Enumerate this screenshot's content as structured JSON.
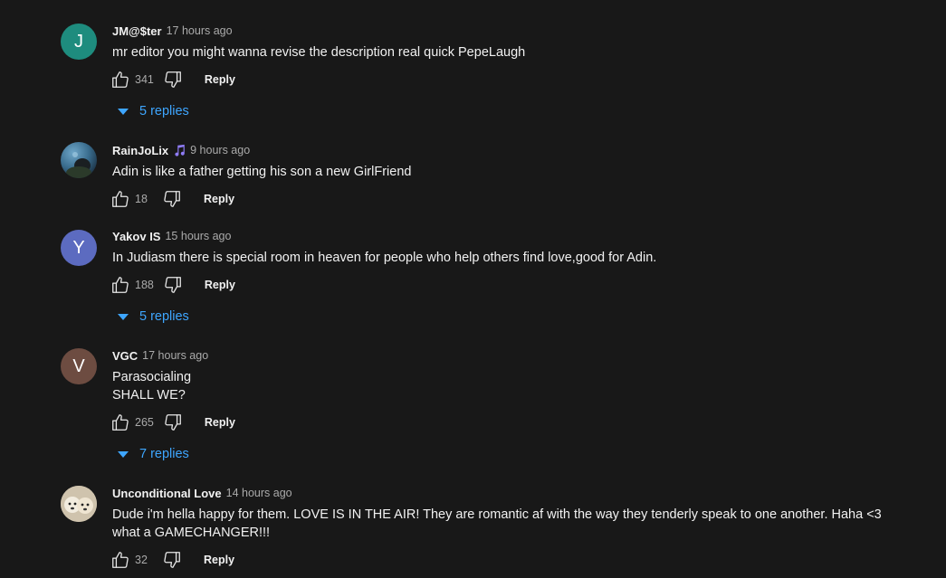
{
  "comments": [
    {
      "author": "JM@$ter",
      "time": "17 hours ago",
      "text": "mr editor you might wanna revise the description real quick PepeLaugh",
      "likes": "341",
      "reply_label": "Reply",
      "replies_label": "5 replies",
      "avatar_letter": "J",
      "avatar_color": "#1e8c7e"
    },
    {
      "author": "RainJoLix",
      "time": "9 hours ago",
      "text": "Adin is like a father getting his son a new GirlFriend",
      "likes": "18",
      "reply_label": "Reply",
      "badge_icon": "music-note-icon",
      "badge_color": "#8f7cf7"
    },
    {
      "author": "Yakov IS",
      "time": "15 hours ago",
      "text": "In Judiasm there is special room in heaven for people who help others find love,good for Adin.",
      "likes": "188",
      "reply_label": "Reply",
      "replies_label": "5 replies",
      "avatar_letter": "Y",
      "avatar_color": "#5c6bc0"
    },
    {
      "author": "VGC",
      "time": "17 hours ago",
      "text": "Parasocialing\nSHALL WE?",
      "likes": "265",
      "reply_label": "Reply",
      "replies_label": "7 replies",
      "avatar_letter": "V",
      "avatar_color": "#6d4c41"
    },
    {
      "author": "Unconditional Love",
      "time": "14 hours ago",
      "text": "Dude i'm hella happy for them. LOVE IS IN THE AIR! They are romantic af with the way they tenderly speak to one another. Haha <3 what a GAMECHANGER!!!",
      "likes": "32",
      "reply_label": "Reply"
    }
  ],
  "colors": {
    "background": "#181818",
    "text": "#f1f1f1",
    "secondary": "#aaaaaa",
    "link": "#3ea6ff"
  }
}
